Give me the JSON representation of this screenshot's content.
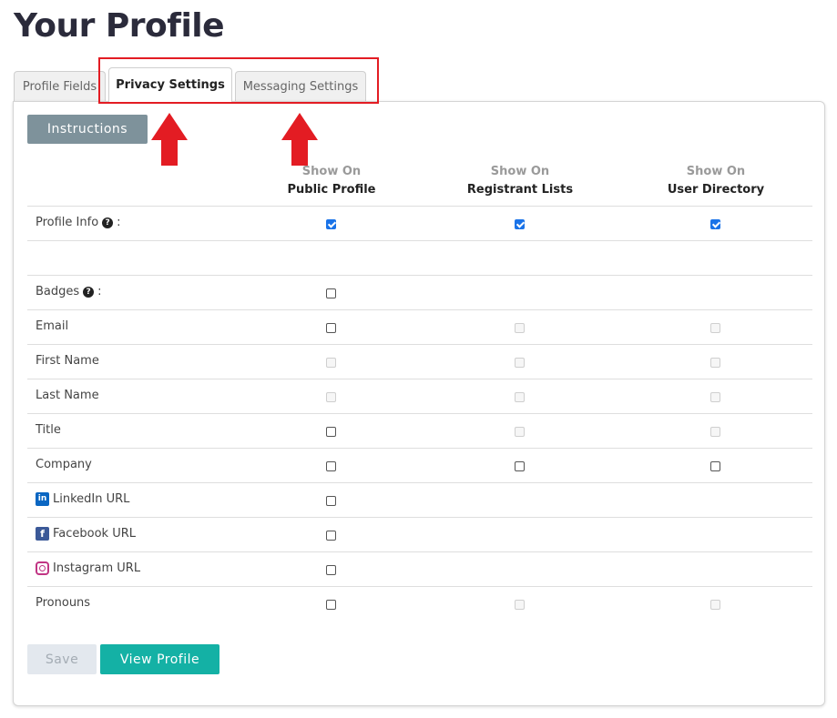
{
  "page": {
    "title": "Your Profile"
  },
  "tabs": [
    {
      "label": "Profile Fields",
      "active": false
    },
    {
      "label": "Privacy Settings",
      "active": true
    },
    {
      "label": "Messaging Settings",
      "active": false
    }
  ],
  "panel": {
    "instructions_label": "Instructions",
    "columns": [
      {
        "line1": "Show On",
        "line2": "Public Profile"
      },
      {
        "line1": "Show On",
        "line2": "Registrant Lists"
      },
      {
        "line1": "Show On",
        "line2": "User Directory"
      }
    ],
    "rows": [
      {
        "label": "Profile Info",
        "suffix": ":",
        "help": true,
        "icon": "",
        "cells": [
          "checked",
          "checked",
          "checked"
        ]
      },
      {
        "label": "",
        "suffix": "",
        "help": false,
        "icon": "",
        "cells": [
          "none",
          "none",
          "none"
        ]
      },
      {
        "label": "Badges",
        "suffix": ":",
        "help": true,
        "icon": "",
        "cells": [
          "unchecked",
          "none",
          "none"
        ]
      },
      {
        "label": "Email",
        "suffix": "",
        "help": false,
        "icon": "",
        "cells": [
          "unchecked",
          "disabled",
          "disabled"
        ]
      },
      {
        "label": "First Name",
        "suffix": "",
        "help": false,
        "icon": "",
        "cells": [
          "disabled",
          "disabled",
          "disabled"
        ]
      },
      {
        "label": "Last Name",
        "suffix": "",
        "help": false,
        "icon": "",
        "cells": [
          "disabled",
          "disabled",
          "disabled"
        ]
      },
      {
        "label": "Title",
        "suffix": "",
        "help": false,
        "icon": "",
        "cells": [
          "unchecked",
          "disabled",
          "disabled"
        ]
      },
      {
        "label": "Company",
        "suffix": "",
        "help": false,
        "icon": "",
        "cells": [
          "unchecked",
          "unchecked",
          "unchecked"
        ]
      },
      {
        "label": "LinkedIn URL",
        "suffix": "",
        "help": false,
        "icon": "linkedin-icon",
        "cells": [
          "unchecked",
          "none",
          "none"
        ]
      },
      {
        "label": "Facebook URL",
        "suffix": "",
        "help": false,
        "icon": "facebook-icon",
        "cells": [
          "unchecked",
          "none",
          "none"
        ]
      },
      {
        "label": "Instagram URL",
        "suffix": "",
        "help": false,
        "icon": "instagram-icon",
        "cells": [
          "unchecked",
          "none",
          "none"
        ]
      },
      {
        "label": "Pronouns",
        "suffix": "",
        "help": false,
        "icon": "",
        "cells": [
          "unchecked",
          "disabled",
          "disabled"
        ]
      }
    ],
    "save_label": "Save",
    "view_profile_label": "View Profile"
  },
  "icons": {
    "help": "question-circle-icon",
    "linkedin_glyph": "in",
    "facebook_glyph": "f",
    "help_glyph": "?"
  },
  "colors": {
    "accent_teal": "#14b1a5",
    "instructions_gray": "#7e929b",
    "annotation_red": "#e31c23",
    "checkbox_blue": "#1a73e8"
  }
}
